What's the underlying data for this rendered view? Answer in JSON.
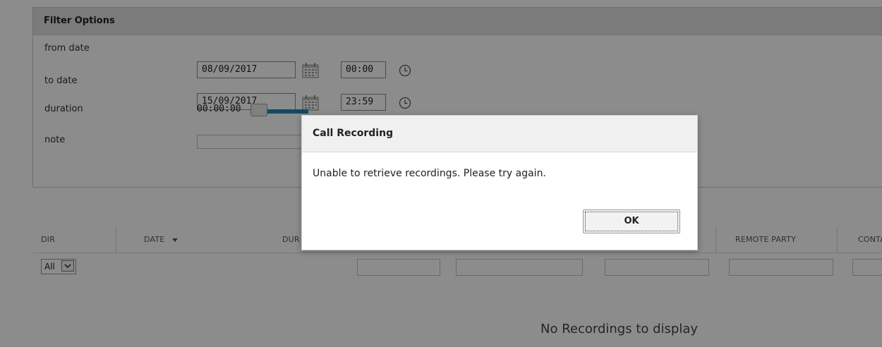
{
  "filter": {
    "title": "Filter Options",
    "from_label": "from date",
    "from_date": "08/09/2017",
    "from_time": "00:00",
    "to_label": "to date",
    "to_date": "15/09/2017",
    "to_time": "23:59",
    "duration_label": "duration",
    "duration_min": "00:00:00",
    "note_label": "note",
    "note_value": ""
  },
  "grid": {
    "columns": [
      "DIR",
      "DATE",
      "DUR",
      "REMOTE PARTY",
      "CONTA"
    ],
    "dir_filter_value": "All",
    "empty_message": "No Recordings to display"
  },
  "dialog": {
    "title": "Call Recording",
    "message": "Unable to retrieve recordings. Please try again.",
    "ok_label": "OK"
  },
  "icons": [
    "calendar-icon",
    "clock-icon",
    "sort-desc-icon",
    "dropdown-arrow-icon"
  ],
  "colors": {
    "slider_accent": "#1e8ab0",
    "overlay": "rgba(0,0,0,0.45)"
  }
}
